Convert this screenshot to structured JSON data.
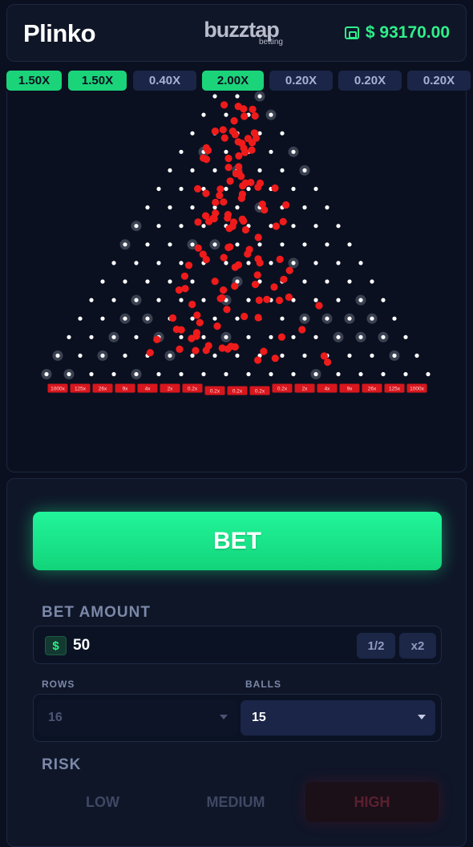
{
  "header": {
    "title": "Plinko",
    "brand_name": "buzztap",
    "brand_sub": "betting",
    "balance": "$ 93170.00",
    "wallet_icon": "wallet-icon"
  },
  "history": [
    "1.50X",
    "1.50X",
    "0.40X",
    "2.00X",
    "0.20X",
    "0.20X",
    "0.20X"
  ],
  "history_win": [
    true,
    true,
    false,
    true,
    false,
    false,
    false
  ],
  "board": {
    "rows": 16,
    "multipliers": [
      "1000x",
      "125x",
      "26x",
      "9x",
      "4x",
      "2x",
      "0.2x",
      "0.2x",
      "0.2x",
      "0.2x",
      "0.2x",
      "2x",
      "4x",
      "9x",
      "26x",
      "125x",
      "1000x"
    ],
    "bucket_color": "#d8161d",
    "peg_color": "#ffffff",
    "ball_color": "#ef1b1b"
  },
  "controls": {
    "bet_label": "BET",
    "bet_amount_label": "BET AMOUNT",
    "currency_symbol": "$",
    "bet_amount_value": "50",
    "half_label": "1/2",
    "double_label": "x2",
    "rows_label": "ROWS",
    "rows_value": "16",
    "balls_label": "BALLS",
    "balls_value": "15",
    "risk_label": "RISK",
    "risk_options": [
      "LOW",
      "MEDIUM",
      "HIGH"
    ],
    "risk_selected": "HIGH"
  }
}
